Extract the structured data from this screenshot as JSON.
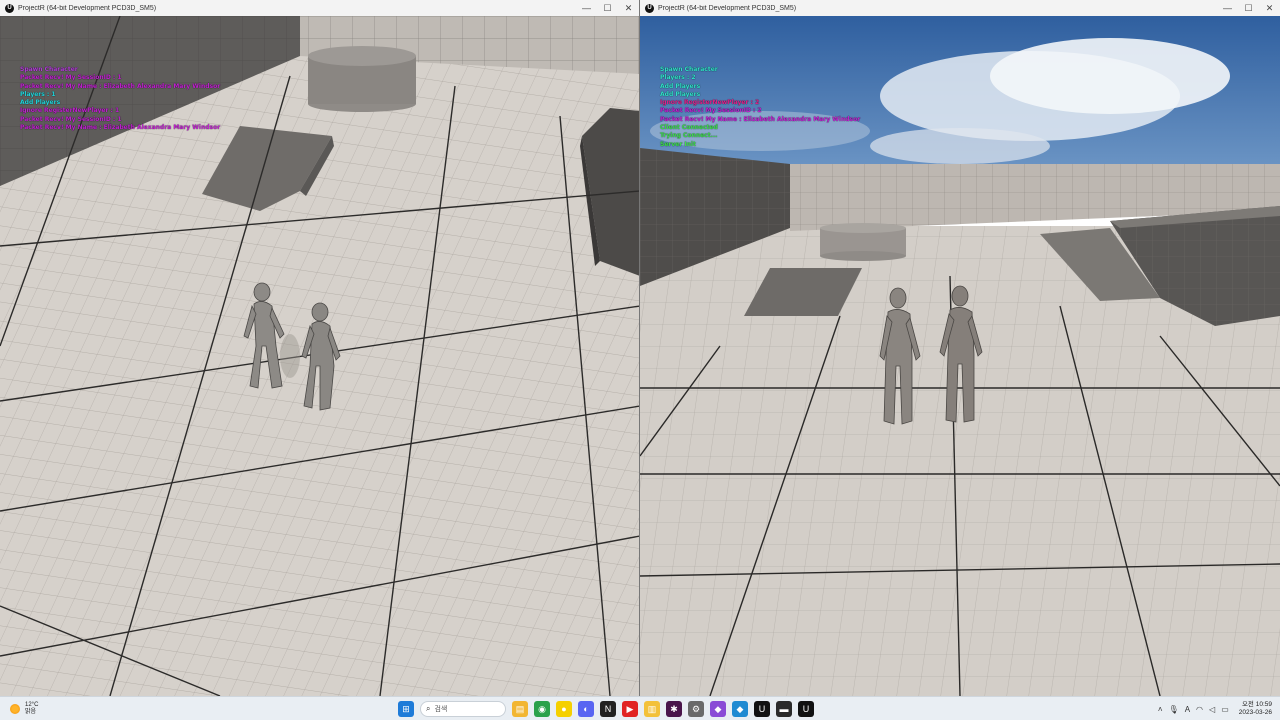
{
  "left_window": {
    "title": "ProjectR (64-bit Development PCD3D_SM5)",
    "log": [
      {
        "text": "Spawn Character",
        "color": "#b03bd6"
      },
      {
        "text": "Packet Recv! My SessionID : 1",
        "color": "#c01fd0"
      },
      {
        "text": "Packet Recv! My Name : Elizabeth Alexandra Mary Windsor",
        "color": "#c01fd0"
      },
      {
        "text": "Players : 1",
        "color": "#1fd3d9"
      },
      {
        "text": "Add Players",
        "color": "#1fd3d9"
      },
      {
        "text": "Ignore RegisterNewPlayer : 1",
        "color": "#c01fd0"
      },
      {
        "text": "Packet Recv! My SessionID : 1",
        "color": "#c01fd0"
      },
      {
        "text": "Packet Recv! My Name : Elizabeth Alexandra Mary Windsor",
        "color": "#c01fd0"
      }
    ]
  },
  "right_window": {
    "title": "ProjectR (64-bit Development PCD3D_SM5)",
    "log": [
      {
        "text": "Spawn Character",
        "color": "#2fe0c8"
      },
      {
        "text": "Players : 2",
        "color": "#2fe0c8"
      },
      {
        "text": "Add Players",
        "color": "#2fe0c8"
      },
      {
        "text": "Add Players",
        "color": "#2fe0c8"
      },
      {
        "text": "Ignore RegisterNewPlayer : 2",
        "color": "#e0208a"
      },
      {
        "text": "Packet Recv! My SessionID : 2",
        "color": "#c01fd0"
      },
      {
        "text": "Packet Recv! My Name : Elizabeth Alexandra Mary Windsor",
        "color": "#c01fd0"
      },
      {
        "text": "Client Connected",
        "color": "#3be04a"
      },
      {
        "text": "Trying Connect...",
        "color": "#3be04a"
      },
      {
        "text": "Server Init",
        "color": "#3be04a"
      }
    ]
  },
  "window_controls": {
    "minimize": "—",
    "maximize": "☐",
    "close": "✕"
  },
  "taskbar": {
    "weather_temp": "12°C",
    "weather_desc": "맑음",
    "search_placeholder": "검색",
    "clock_time": "오전 10:59",
    "clock_date": "2023-03-26",
    "icons": [
      {
        "name": "windows-start-icon",
        "glyph": "⊞",
        "color": "#1e7bd8"
      },
      {
        "name": "file-explorer-icon",
        "glyph": "▤",
        "color": "#f2b632"
      },
      {
        "name": "chrome-icon",
        "glyph": "◉",
        "color": "#2aa14a"
      },
      {
        "name": "kakaotalk-icon",
        "glyph": "●",
        "color": "#f5d000"
      },
      {
        "name": "discord-icon",
        "glyph": "◐",
        "color": "#5865f2"
      },
      {
        "name": "notion-icon",
        "glyph": "N",
        "color": "#222222"
      },
      {
        "name": "youtube-music-icon",
        "glyph": "▶",
        "color": "#e12424"
      },
      {
        "name": "notes-icon",
        "glyph": "▥",
        "color": "#f3c13a"
      },
      {
        "name": "slack-icon",
        "glyph": "✱",
        "color": "#4a154b"
      },
      {
        "name": "settings-icon",
        "glyph": "⚙",
        "color": "#6a6a6a"
      },
      {
        "name": "visual-studio-icon",
        "glyph": "◆",
        "color": "#8a4bd6"
      },
      {
        "name": "vscode-icon",
        "glyph": "◆",
        "color": "#1f8ad2"
      },
      {
        "name": "unreal-editor-icon",
        "glyph": "U",
        "color": "#111111"
      },
      {
        "name": "terminal-icon",
        "glyph": "▬",
        "color": "#2b2b2b"
      },
      {
        "name": "unreal-game-icon",
        "glyph": "U",
        "color": "#111111"
      }
    ]
  }
}
